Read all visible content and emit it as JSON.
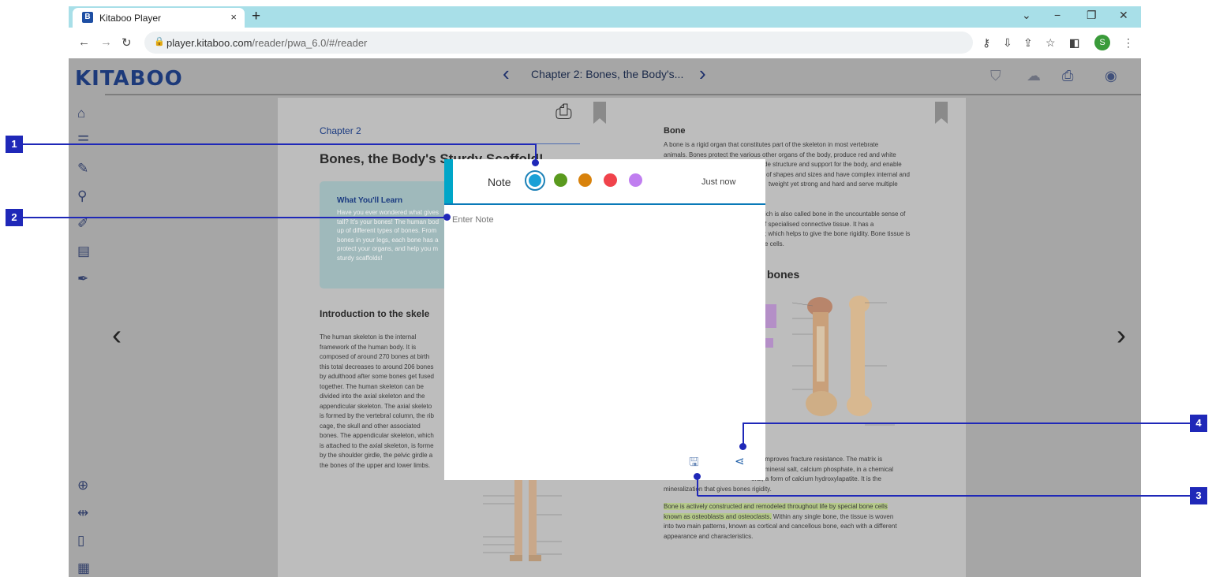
{
  "browser": {
    "tab_title": "Kitaboo Player",
    "tab_close": "×",
    "new_tab": "+",
    "url_host": "player.kitaboo.com",
    "url_path": "/reader/pwa_6.0/#/reader",
    "profile_initial": "S"
  },
  "header": {
    "logo": "KITABOO",
    "chapter_title": "Chapter 2: Bones, the Body's..."
  },
  "left_page": {
    "chapter_label": "Chapter 2",
    "heading": "Bones, the Body's Sturdy Scaffold!",
    "learn_box_title": "What You'll Learn",
    "learn_box_text": [
      "Have you ever wondered what gives",
      "tall? It's your bones! The human bod",
      "up of different types of bones. From",
      "bones in your legs, each bone has a",
      "protect your organs, and help you m",
      "sturdy scaffolds!"
    ],
    "intro_heading": "Introduction to the skele",
    "intro_text": [
      "The human skeleton is the internal",
      "framework of the human body. It is",
      "composed of around 270 bones at birth",
      "this total decreases to around 206 bones",
      "by adulthood after some bones get fused",
      "together. The human skeleton can be",
      "divided into the axial skeleton and the",
      "appendicular skeleton. The axial skeleto",
      "is formed by the vertebral column, the rib",
      "cage, the skull and other associated",
      "bones. The appendicular skeleton, which",
      "is attached to the axial skeleton, is forme",
      "by the shoulder girdle, the pelvic girdle a",
      "the bones of the upper and lower limbs."
    ]
  },
  "right_page": {
    "heading": "Bone",
    "para1": [
      "A bone is a rigid organ that constitutes part of the skeleton in most vertebrate",
      "animals. Bones protect the various other organs of the body, produce red and white",
      "de structure and support for the body, and enable",
      "of shapes and sizes and have complex internal and",
      "tweight yet strong and hard and serve multiple"
    ],
    "para2": [
      "ich is also called bone in the uncountable sense of",
      "f specialised connective tissue. It has a",
      "; which helps to give the bone rigidity. Bone tissue is",
      "e cells."
    ],
    "subheading": "bones",
    "para3": [
      "gen improves fracture resistance. The matrix is",
      "anic mineral salt, calcium phosphate, in a chemical",
      "eral, a form of calcium hydroxylapatite. It is the",
      "mineralization that gives bones rigidity."
    ],
    "highlight_text": [
      "Bone is actively constructed and remodeled throughout life by special bone cells",
      "known as osteoblasts and osteoclasts."
    ],
    "para4": [
      "Within any single bone, the tissue is woven",
      "into two main patterns, known as cortical and cancellous bone, each with a different",
      "appearance and characteristics."
    ]
  },
  "note_popup": {
    "label": "Note",
    "timestamp": "Just now",
    "placeholder": "Enter Note",
    "colors": [
      "#1aa0d6",
      "#5a9a1e",
      "#d8820c",
      "#f0434b",
      "#c07ef0"
    ]
  },
  "callouts": [
    "1",
    "2",
    "3",
    "4"
  ]
}
